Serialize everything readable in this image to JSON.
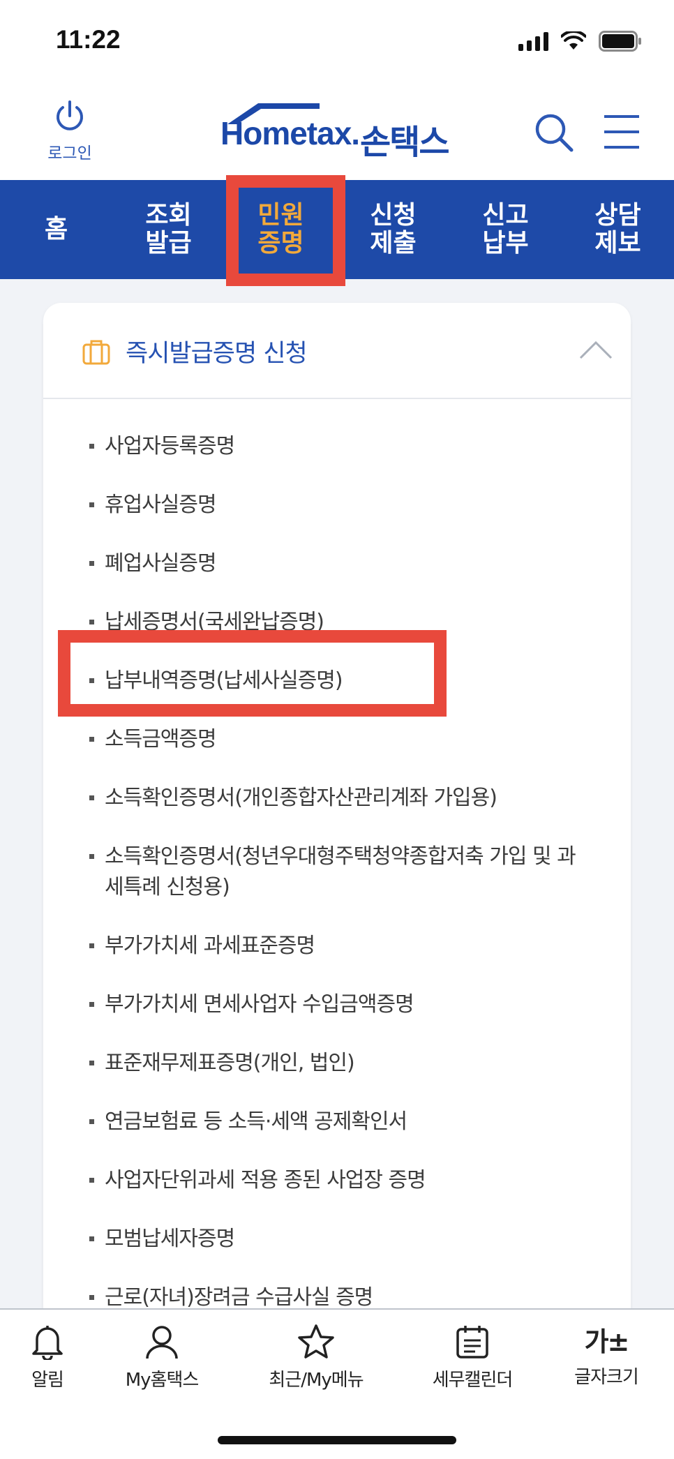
{
  "status": {
    "time": "11:22"
  },
  "header": {
    "login_label": "로그인",
    "logo_text": "Hometax.",
    "logo_kr": "손택스"
  },
  "nav": {
    "items": [
      {
        "label": "홈"
      },
      {
        "label": "조회\n발급"
      },
      {
        "label": "민원\n증명"
      },
      {
        "label": "신청\n제출"
      },
      {
        "label": "신고\n납부"
      },
      {
        "label": "상담\n제보"
      }
    ],
    "active_index": 2
  },
  "panel": {
    "title": "즉시발급증명 신청",
    "items": [
      "사업자등록증명",
      "휴업사실증명",
      "폐업사실증명",
      "납세증명서(국세완납증명)",
      "납부내역증명(납세사실증명)",
      "소득금액증명",
      "소득확인증명서(개인종합자산관리계좌 가입용)",
      "소득확인증명서(청년우대형주택청약종합저축 가입 및 과세특례 신청용)",
      "부가가치세 과세표준증명",
      "부가가치세 면세사업자 수입금액증명",
      "표준재무제표증명(개인, 법인)",
      "연금보험료 등 소득·세액 공제확인서",
      "사업자단위과세 적용 종된 사업장 증명",
      "모범납세자증명",
      "근로(자녀)장려금 수급사실 증명"
    ]
  },
  "bottom_bar": {
    "tabs": [
      {
        "label": "알림",
        "icon": "bell-icon"
      },
      {
        "label": "My홈택스",
        "icon": "person-icon"
      },
      {
        "label": "최근/My메뉴",
        "icon": "star-icon"
      },
      {
        "label": "세무캘린더",
        "icon": "calendar-icon"
      },
      {
        "label": "글자크기",
        "icon": "font-size-icon",
        "glyph": "가±"
      }
    ]
  },
  "colors": {
    "brand_blue": "#1e4aa8",
    "active_orange": "#f2a93b",
    "highlight_red": "#e8493c"
  }
}
